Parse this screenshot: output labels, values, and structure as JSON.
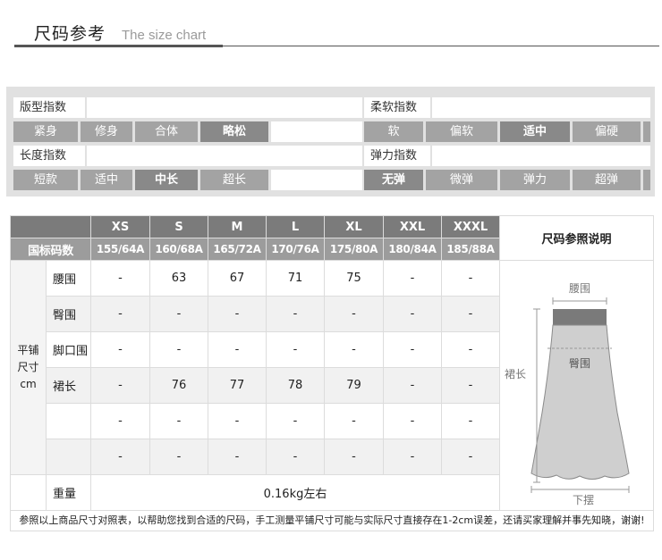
{
  "header": {
    "title": "尺码参考",
    "subtitle": "The size chart"
  },
  "index": {
    "fit_label": "版型指数",
    "fit_options": [
      "紧身",
      "修身",
      "合体",
      "略松"
    ],
    "fit_selected": 3,
    "soft_label": "柔软指数",
    "soft_options": [
      "软",
      "偏软",
      "适中",
      "偏硬"
    ],
    "soft_selected": 2,
    "length_label": "长度指数",
    "length_options": [
      "短款",
      "适中",
      "中长",
      "超长"
    ],
    "length_selected": 2,
    "stretch_label": "弹力指数",
    "stretch_options": [
      "无弹",
      "微弹",
      "弹力",
      "超弹"
    ],
    "stretch_selected": 0
  },
  "table": {
    "sizes": [
      "XS",
      "S",
      "M",
      "L",
      "XL",
      "XXL",
      "XXXL"
    ],
    "cn_label": "国标码数",
    "cn_sizes": [
      "155/64A",
      "160/68A",
      "165/72A",
      "170/76A",
      "175/80A",
      "180/84A",
      "185/88A"
    ],
    "diagram_title": "尺码参照说明",
    "side_label": [
      "平铺",
      "尺寸",
      "cm"
    ],
    "rows": [
      {
        "label": "腰围",
        "values": [
          "-",
          "63",
          "67",
          "71",
          "75",
          "-",
          "-"
        ]
      },
      {
        "label": "臀围",
        "values": [
          "-",
          "-",
          "-",
          "-",
          "-",
          "-",
          "-"
        ]
      },
      {
        "label": "脚口围",
        "values": [
          "-",
          "-",
          "-",
          "-",
          "-",
          "-",
          "-"
        ]
      },
      {
        "label": "裙长",
        "values": [
          "-",
          "76",
          "77",
          "78",
          "79",
          "-",
          "-"
        ]
      },
      {
        "label": "",
        "values": [
          "-",
          "-",
          "-",
          "-",
          "-",
          "-",
          "-"
        ]
      },
      {
        "label": "",
        "values": [
          "-",
          "-",
          "-",
          "-",
          "-",
          "-",
          "-"
        ]
      }
    ],
    "weight_label": "重量",
    "weight_value": "0.16kg左右",
    "note": "参照以上商品尺寸对照表，以帮助您找到合适的尺码，手工测量平铺尺寸可能与实际尺寸直接存在1-2cm误差，还请买家理解并事先知晓，谢谢!"
  },
  "diagram": {
    "waist": "腰围",
    "hip": "臀围",
    "length": "裙长",
    "hem": "下摆"
  }
}
